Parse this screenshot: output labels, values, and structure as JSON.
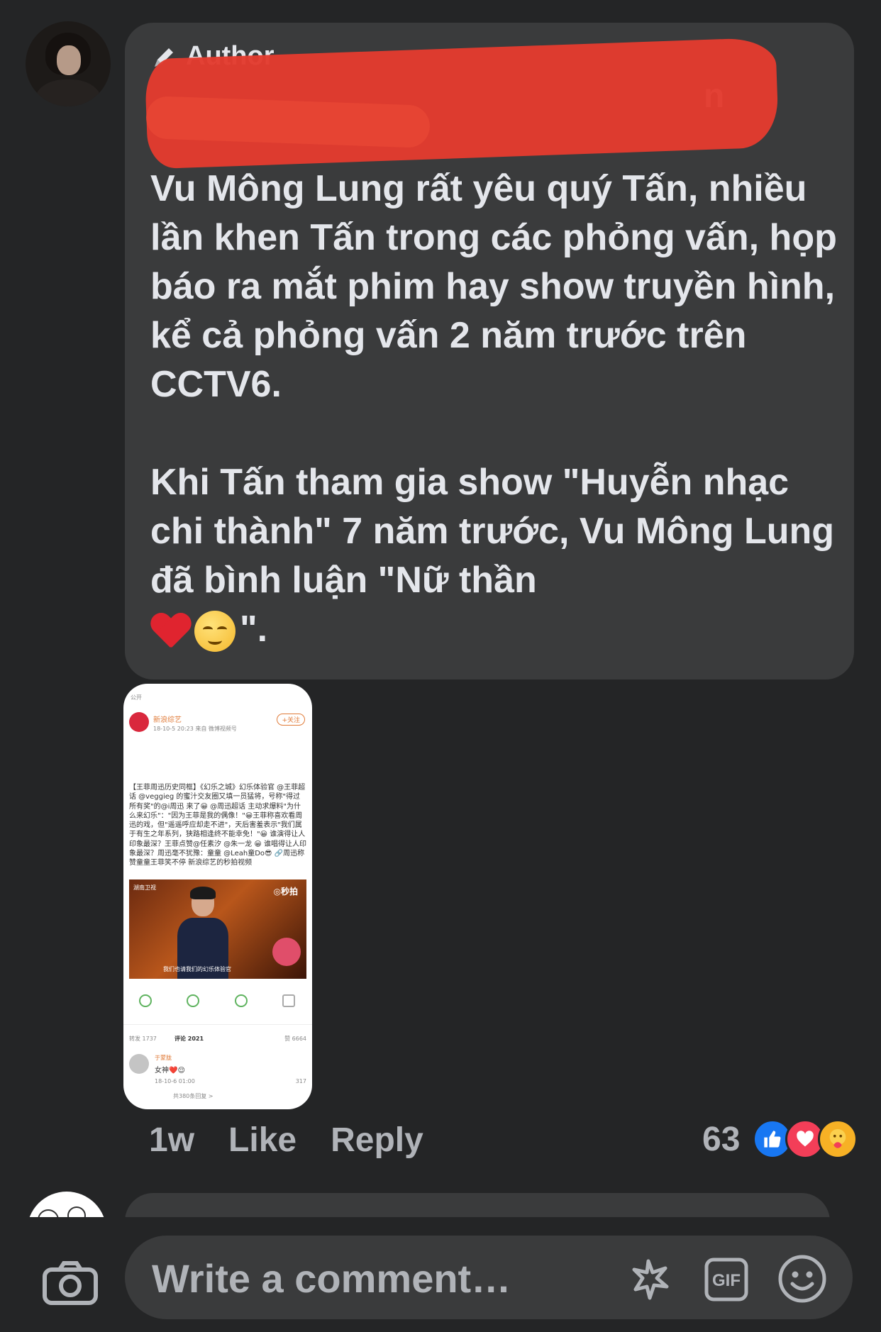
{
  "comment": {
    "badge_label": "Author",
    "author_visible_fragment": "n",
    "paragraph1": "Vu Mông Lung rất yêu quý Tấn, nhiều lần khen Tấn trong các phỏng vấn, họp báo ra mắt phim hay show truyền hình, kể cả phỏng vấn 2 năm trước trên CCTV6.",
    "paragraph2_text": "Khi Tấn tham gia show \"Huyễn nhạc chi thành\" 7 năm trước, Vu Mông Lung đã bình luận \"Nữ thần",
    "paragraph2_end": "\".",
    "emoji_icons": [
      "red-heart-icon",
      "relieved-face-icon"
    ]
  },
  "attachment": {
    "visibility": "公开",
    "account": "新浪综艺",
    "post_meta": "18-10-5 20:23 来自 微博视频号",
    "follow_label": "+关注",
    "body": "【王菲周迅历史同框】《幻乐之城》幻乐体验官 @王菲超话 @veggieg 的蜜汁交友圈又填一员猛将，号称\"得过所有奖\"的@i周迅 来了😀 @周迅超话 主动求爆料\"为什么来幻乐\"：\"因为王菲是我的偶像！\"😀王菲称喜欢看周迅的戏，但\"遥遥呼应却走不进\"，天后害羞表示\"我们属于有生之年系列，狭路相逢终不能幸免！\"😀 谁演得让人印象最深？王菲点赞@任素汐 @朱一龙 😀 谁唱得让人印象最深？周迅毫不犹豫：童童 @Leah童Do😎 🔗周迅称赞童童王菲笑不停 新浪综艺的秒拍视频",
    "video_channel": "湖南卫视",
    "video_logo": "◎秒拍",
    "video_caption": "我们也请我们的幻乐体验官",
    "reposts": "转发 1737",
    "comments": "评论 2021",
    "likes": "赞 6664",
    "reply_user": "于蒙胧",
    "reply_text": "女神❤️😌",
    "reply_time": "18-10-6 01:00",
    "reply_likes": "317",
    "more_replies": "共380条回复 >"
  },
  "actions": {
    "time": "1w",
    "like": "Like",
    "reply": "Reply",
    "reaction_count": "63",
    "reaction_icons": [
      "like-reaction-icon",
      "love-reaction-icon",
      "care-reaction-icon"
    ]
  },
  "composer": {
    "placeholder": "Write a comment…",
    "icons": [
      "camera-icon",
      "sticker-icon",
      "gif-icon",
      "emoji-icon"
    ]
  },
  "colors": {
    "background": "#242526",
    "bubble": "#3a3b3c",
    "text": "#e4e6eb",
    "muted": "#b0b3b8",
    "like_blue": "#1877f2",
    "love_red": "#f33e58",
    "care_yellow": "#f7b125",
    "redaction_red": "#e23b2e"
  }
}
